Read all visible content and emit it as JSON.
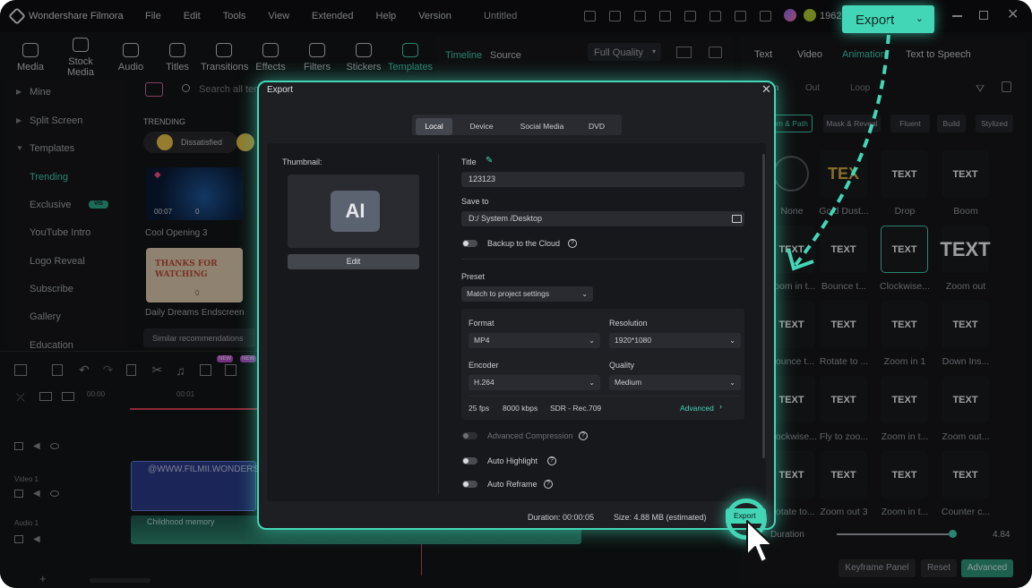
{
  "app": {
    "name": "Wondershare Filmora",
    "project_title": "Untitled",
    "menu": [
      "File",
      "Edit",
      "Tools",
      "View",
      "Extended",
      "Help",
      "Version"
    ],
    "credits": "1962"
  },
  "top_export_button": {
    "label": "Export"
  },
  "toolbar": {
    "items": [
      "Media",
      "Stock Media",
      "Audio",
      "Titles",
      "Transitions",
      "Effects",
      "Filters",
      "Stickers",
      "Templates"
    ]
  },
  "sidebar": {
    "items": [
      "Mine",
      "Split Screen",
      "Templates",
      "Trending",
      "Exclusive",
      "YouTube Intro",
      "Logo Reveal",
      "Subscribe",
      "Gallery",
      "Education"
    ],
    "exclusive_badge": "VIS"
  },
  "browser": {
    "search_placeholder": "Search all tem",
    "section": "TRENDING",
    "chip": "Dissatisfied",
    "cards": [
      {
        "name": "Cool Opening 3",
        "time": "00:07",
        "count": "0"
      },
      {
        "name": "Daily Dreams Endscreen",
        "art": "THANKS FOR WATCHING",
        "count": "0"
      }
    ],
    "similar": "Similar recommendations"
  },
  "preview": {
    "tabs": [
      "Timeline",
      "Source"
    ],
    "quality": "Full Quality"
  },
  "timeline": {
    "ruler": [
      "00:00",
      "00:01"
    ],
    "tracks": [
      "Video 1",
      "Audio 1"
    ],
    "video_clip": "@WWW.FILMII.WONDERS",
    "audio_clip": "Childhood memory",
    "new_badge": "NEW"
  },
  "right_panel": {
    "tabs": [
      "Text",
      "Video",
      "Animation",
      "Text to Speech"
    ],
    "subtabs": [
      "In",
      "Out",
      "Loop"
    ],
    "categories": [
      "Zoom & Path",
      "Mask & Reveal",
      "Fluent",
      "Build",
      "Stylized"
    ],
    "effects": [
      {
        "label": "None",
        "art": ""
      },
      {
        "label": "Gold Dust...",
        "art": "TEX"
      },
      {
        "label": "Drop",
        "art": "TEXT"
      },
      {
        "label": "Boom",
        "art": "TEXT"
      },
      {
        "label": "Zoom in t...",
        "art": "TEXT"
      },
      {
        "label": "Bounce t...",
        "art": "TEXT"
      },
      {
        "label": "Clockwise...",
        "art": "TEXT"
      },
      {
        "label": "Zoom out",
        "art": "TEXT"
      },
      {
        "label": "Bounce t...",
        "art": "TEXT"
      },
      {
        "label": "Rotate to ...",
        "art": "TEXT"
      },
      {
        "label": "Zoom in 1",
        "art": "TEXT"
      },
      {
        "label": "Down Ins...",
        "art": "TEXT"
      },
      {
        "label": "Clockwise...",
        "art": "TEXT"
      },
      {
        "label": "Fly to zoo...",
        "art": "TEXT"
      },
      {
        "label": "Zoom in t...",
        "art": "TEXT"
      },
      {
        "label": "Zoom out...",
        "art": "TEXT"
      },
      {
        "label": "Rotate to...",
        "art": "TEXT"
      },
      {
        "label": "Zoom out 3",
        "art": "TEXT"
      },
      {
        "label": "Zoom in t...",
        "art": "TEXT"
      },
      {
        "label": "Counter c...",
        "art": "TEXT"
      }
    ],
    "duration_label": "Duration",
    "duration_value": "4.84",
    "buttons": [
      "Keyframe Panel",
      "Reset",
      "Advanced"
    ]
  },
  "export_dialog": {
    "title": "Export",
    "tabs": [
      "Local",
      "Device",
      "Social Media",
      "DVD"
    ],
    "thumbnail_label": "Thumbnail:",
    "thumbnail_art": "AI",
    "edit_button": "Edit",
    "title_label": "Title",
    "title_value": "123123",
    "save_to_label": "Save to",
    "save_to_value": "D:/ System /Desktop",
    "backup_label": "Backup to the Cloud",
    "preset_label": "Preset",
    "preset_value": "Match to project settings",
    "format_label": "Format",
    "format_value": "MP4",
    "resolution_label": "Resolution",
    "resolution_value": "1920*1080",
    "encoder_label": "Encoder",
    "encoder_value": "H.264",
    "quality_label": "Quality",
    "quality_value": "Medium",
    "fps": "25 fps",
    "bitrate": "8000 kbps",
    "color": "SDR - Rec.709",
    "advanced_link": "Advanced",
    "advanced_compression": "Advanced Compression",
    "auto_highlight": "Auto Highlight",
    "auto_reframe": "Auto Reframe",
    "duration": "Duration: 00:00:05",
    "size": "Size:  4.88 MB (estimated)",
    "export_button": "Export"
  },
  "colors": {
    "accent": "#43d6b6",
    "background": "#141518",
    "panel": "#1e1f23"
  }
}
